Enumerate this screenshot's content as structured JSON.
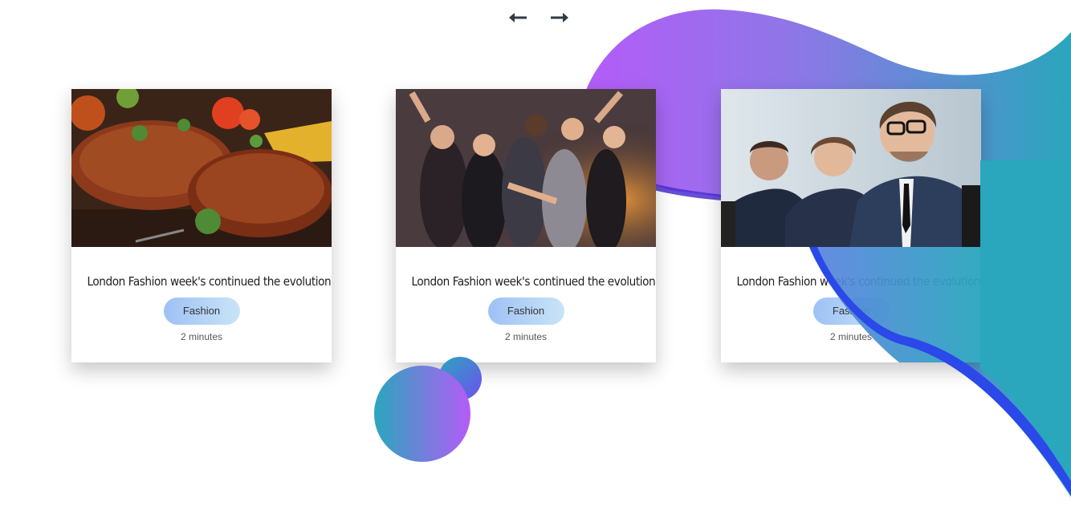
{
  "nav": {
    "prev_icon": "arrow-left-icon",
    "next_icon": "arrow-right-icon"
  },
  "colors": {
    "purple": "#b45cf8",
    "teal": "#2aa6bd",
    "blue": "#2b48e8"
  },
  "cards": [
    {
      "image": "grilled-steak-photo",
      "title": "London Fashion week's continued the evolution",
      "tag": "Fashion",
      "meta": "2 minutes"
    },
    {
      "image": "party-crowd-photo",
      "title": "London Fashion week's continued the evolution",
      "tag": "Fashion",
      "meta": "2 minutes"
    },
    {
      "image": "business-people-photo",
      "title": "London Fashion week's continued the evolution",
      "tag": "Fashion",
      "meta": "2 minutes"
    }
  ]
}
